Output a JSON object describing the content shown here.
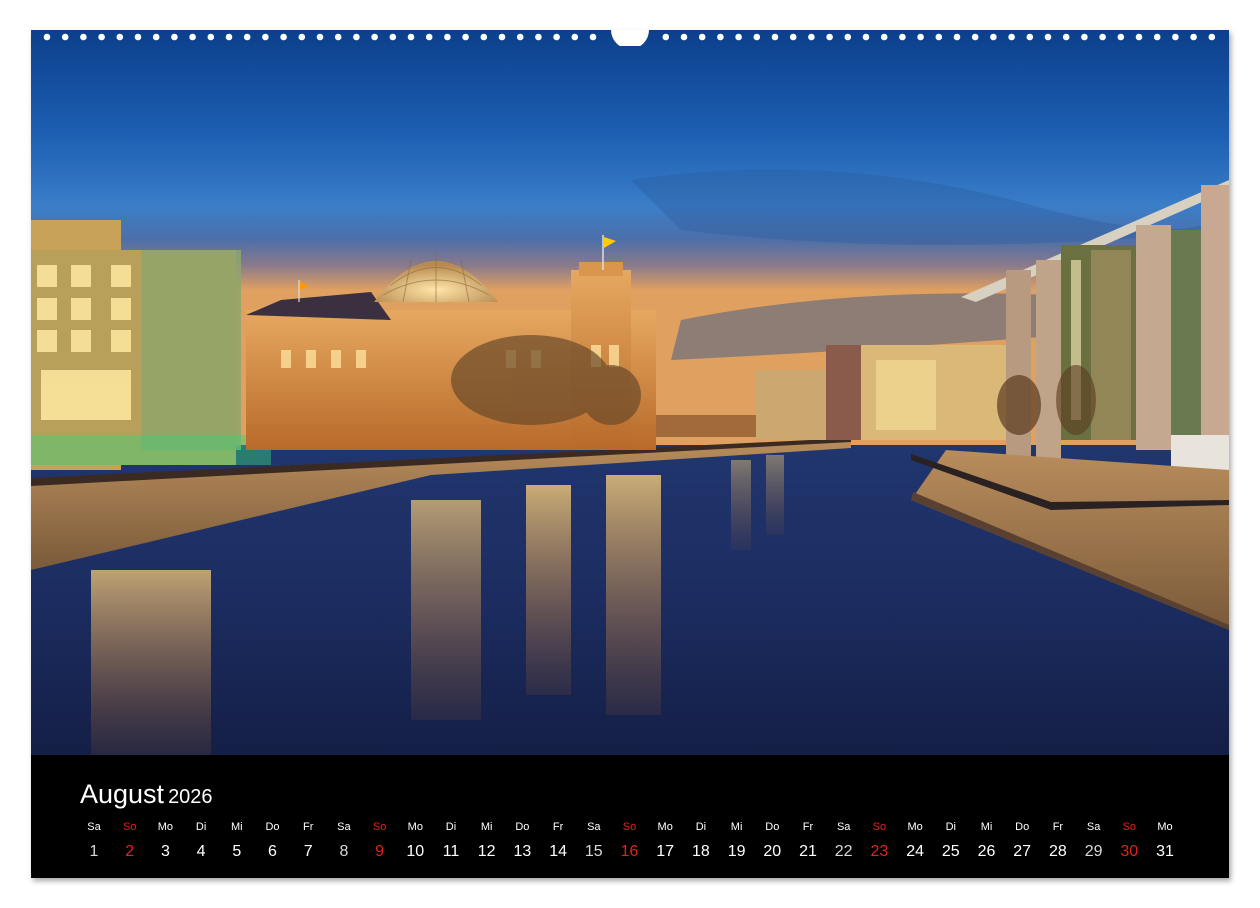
{
  "photo": {
    "subject": "Reichstag building and government buildings along the Spree river at dusk"
  },
  "calendar": {
    "month": "August",
    "year": "2026",
    "accent_color": "#e2231a",
    "days": [
      {
        "wd": "Sa",
        "d": "1"
      },
      {
        "wd": "So",
        "d": "2"
      },
      {
        "wd": "Mo",
        "d": "3"
      },
      {
        "wd": "Di",
        "d": "4"
      },
      {
        "wd": "Mi",
        "d": "5"
      },
      {
        "wd": "Do",
        "d": "6"
      },
      {
        "wd": "Fr",
        "d": "7"
      },
      {
        "wd": "Sa",
        "d": "8"
      },
      {
        "wd": "So",
        "d": "9"
      },
      {
        "wd": "Mo",
        "d": "10"
      },
      {
        "wd": "Di",
        "d": "11"
      },
      {
        "wd": "Mi",
        "d": "12"
      },
      {
        "wd": "Do",
        "d": "13"
      },
      {
        "wd": "Fr",
        "d": "14"
      },
      {
        "wd": "Sa",
        "d": "15"
      },
      {
        "wd": "So",
        "d": "16"
      },
      {
        "wd": "Mo",
        "d": "17"
      },
      {
        "wd": "Di",
        "d": "18"
      },
      {
        "wd": "Mi",
        "d": "19"
      },
      {
        "wd": "Do",
        "d": "20"
      },
      {
        "wd": "Fr",
        "d": "21"
      },
      {
        "wd": "Sa",
        "d": "22"
      },
      {
        "wd": "So",
        "d": "23"
      },
      {
        "wd": "Mo",
        "d": "24"
      },
      {
        "wd": "Di",
        "d": "25"
      },
      {
        "wd": "Mi",
        "d": "26"
      },
      {
        "wd": "Do",
        "d": "27"
      },
      {
        "wd": "Fr",
        "d": "28"
      },
      {
        "wd": "Sa",
        "d": "29"
      },
      {
        "wd": "So",
        "d": "30"
      },
      {
        "wd": "Mo",
        "d": "31"
      }
    ]
  }
}
